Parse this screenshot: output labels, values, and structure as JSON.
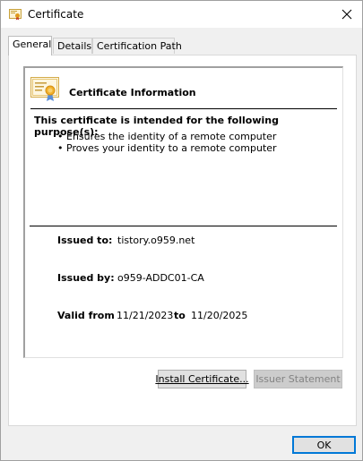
{
  "window": {
    "title": "Certificate",
    "close_icon": "close-icon",
    "title_icon": "certificate-icon"
  },
  "tabs": [
    {
      "label": "General",
      "selected": true
    },
    {
      "label": "Details",
      "selected": false
    },
    {
      "label": "Certification Path",
      "selected": false
    }
  ],
  "general": {
    "info_icon": "certificate-ribbon-icon",
    "heading": "Certificate Information",
    "purpose_heading": "This certificate is intended for the following purpose(s):",
    "purposes": [
      "Ensures the identity of a remote computer",
      "Proves your identity to a remote computer"
    ],
    "issued_to_label": "Issued to:",
    "issued_to_value": "tistory.o959.net",
    "issued_by_label": "Issued by:",
    "issued_by_value": "o959-ADDC01-CA",
    "valid_from_label": "Valid from",
    "valid_from_value": "11/21/2023",
    "valid_to_label": "to",
    "valid_to_value": "11/20/2025"
  },
  "buttons": {
    "install": "Install Certificate...",
    "issuer": "Issuer Statement",
    "ok": "OK"
  },
  "colors": {
    "accent": "#0078d7",
    "window_bg": "#f0f0f0",
    "disabled_text": "#838383"
  }
}
